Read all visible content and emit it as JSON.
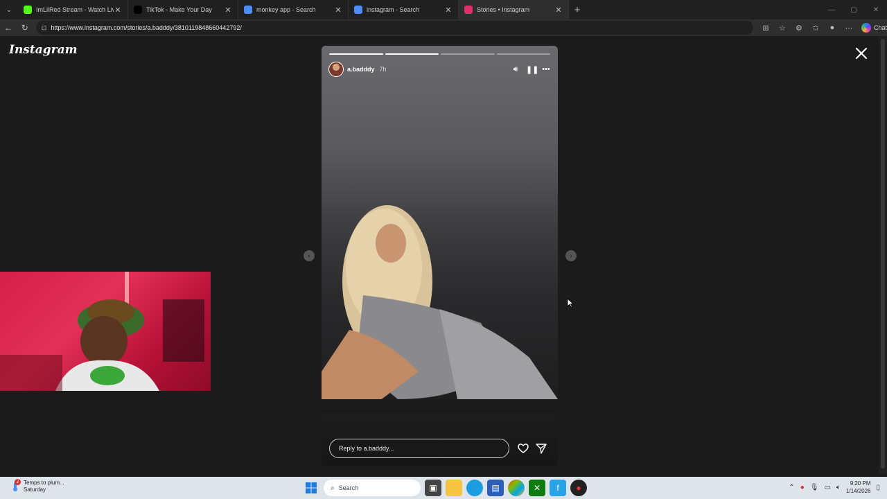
{
  "tabs": [
    {
      "title": "ImLilRed Stream - Watch Live on K",
      "favicon": "kick-icon",
      "color": "#53fc18"
    },
    {
      "title": "TikTok - Make Your Day",
      "favicon": "tiktok-icon",
      "color": "#000000"
    },
    {
      "title": "monkey app - Search",
      "favicon": "search-icon",
      "color": "#4d8df5"
    },
    {
      "title": "instagram - Search",
      "favicon": "search-icon",
      "color": "#4d8df5"
    },
    {
      "title": "Stories • Instagram",
      "favicon": "instagram-icon",
      "color": "#e1306c",
      "active": true
    }
  ],
  "address": {
    "url": "https://www.instagram.com/stories/a.badddy/3810119848660442792/"
  },
  "browser": {
    "chat_label": "Chat"
  },
  "instagram": {
    "logo": "Instagram"
  },
  "story": {
    "progress": [
      1.0,
      1.0,
      0.0,
      0.0
    ],
    "username": "a.badddy",
    "age": "7h",
    "reply_placeholder": "Reply to a.badddy..."
  },
  "taskbar": {
    "weather_title": "Temps to plum...",
    "weather_sub": "Saturday",
    "weather_badge": "2",
    "search_label": "Search",
    "time": "9:20 PM",
    "date": "1/14/2026"
  },
  "colors": {
    "accent": "#0a84ff",
    "background": "#1b1b1b"
  }
}
